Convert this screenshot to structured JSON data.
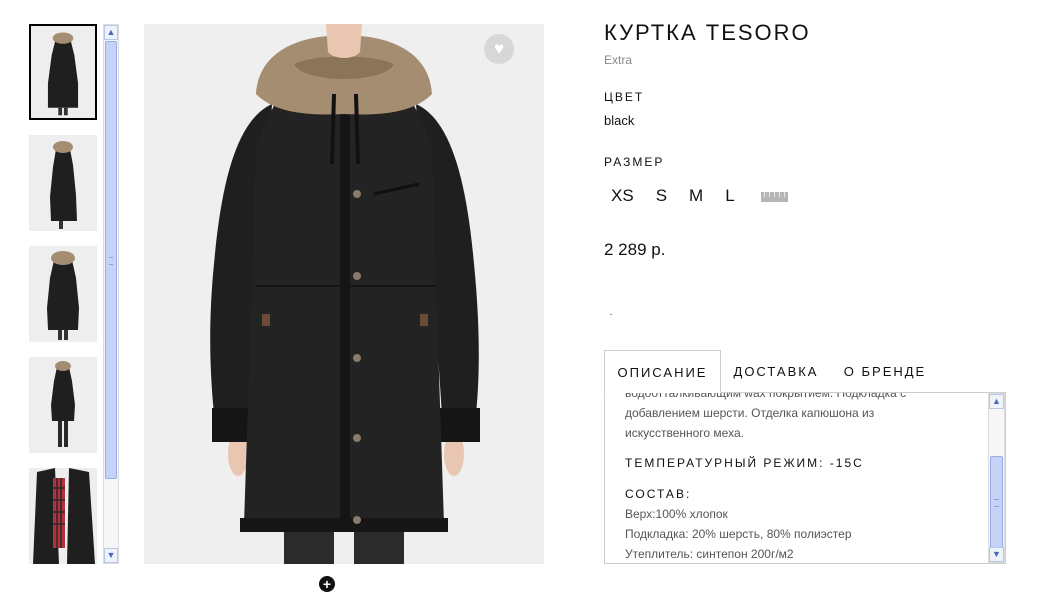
{
  "thumbnails": [
    {
      "name": "front view",
      "active": true
    },
    {
      "name": "side view",
      "active": false
    },
    {
      "name": "back view",
      "active": false
    },
    {
      "name": "full length view",
      "active": false
    },
    {
      "name": "open lining view",
      "active": false
    }
  ],
  "icons": {
    "wishlist": "heart-icon",
    "zoom": "plus-icon",
    "size_guide": "ruler-icon",
    "scroll_up": "arrow-up-icon",
    "scroll_down": "arrow-down-icon"
  },
  "glyphs": {
    "heart": "♥",
    "plus": "+",
    "up": "▲",
    "down": "▼"
  },
  "product": {
    "title": "КУРТКА TESORO",
    "brand": "Extra",
    "color_label": "ЦВЕТ",
    "color_value": "black",
    "size_label": "РАЗМЕР",
    "sizes": [
      "XS",
      "S",
      "M",
      "L"
    ],
    "price": "2 289 р."
  },
  "tabs": [
    {
      "label": "ОПИСАНИЕ",
      "active": true
    },
    {
      "label": "ДОСТАВКА",
      "active": false
    },
    {
      "label": "О БРЕНДЕ",
      "active": false
    }
  ],
  "description": {
    "lines": [
      "водоотталкивающим wax покрытием. Подкладка с",
      "добавлением шерсти. Отделка капюшона из",
      "искусственного меха."
    ],
    "temperature": "ТЕМПЕРАТУРНЫЙ РЕЖИМ: -15С",
    "composition_label": "СОСТАВ:",
    "composition": [
      "Верх:100% хлопок",
      "Подкладка: 20% шерсть, 80% полиэстер",
      "Утеплитель: синтепон 200г/м2"
    ]
  },
  "colors": {
    "jacket": "#1f1f1f",
    "fur": "#a48d70",
    "scroll_accent": "#c4d3f6"
  }
}
